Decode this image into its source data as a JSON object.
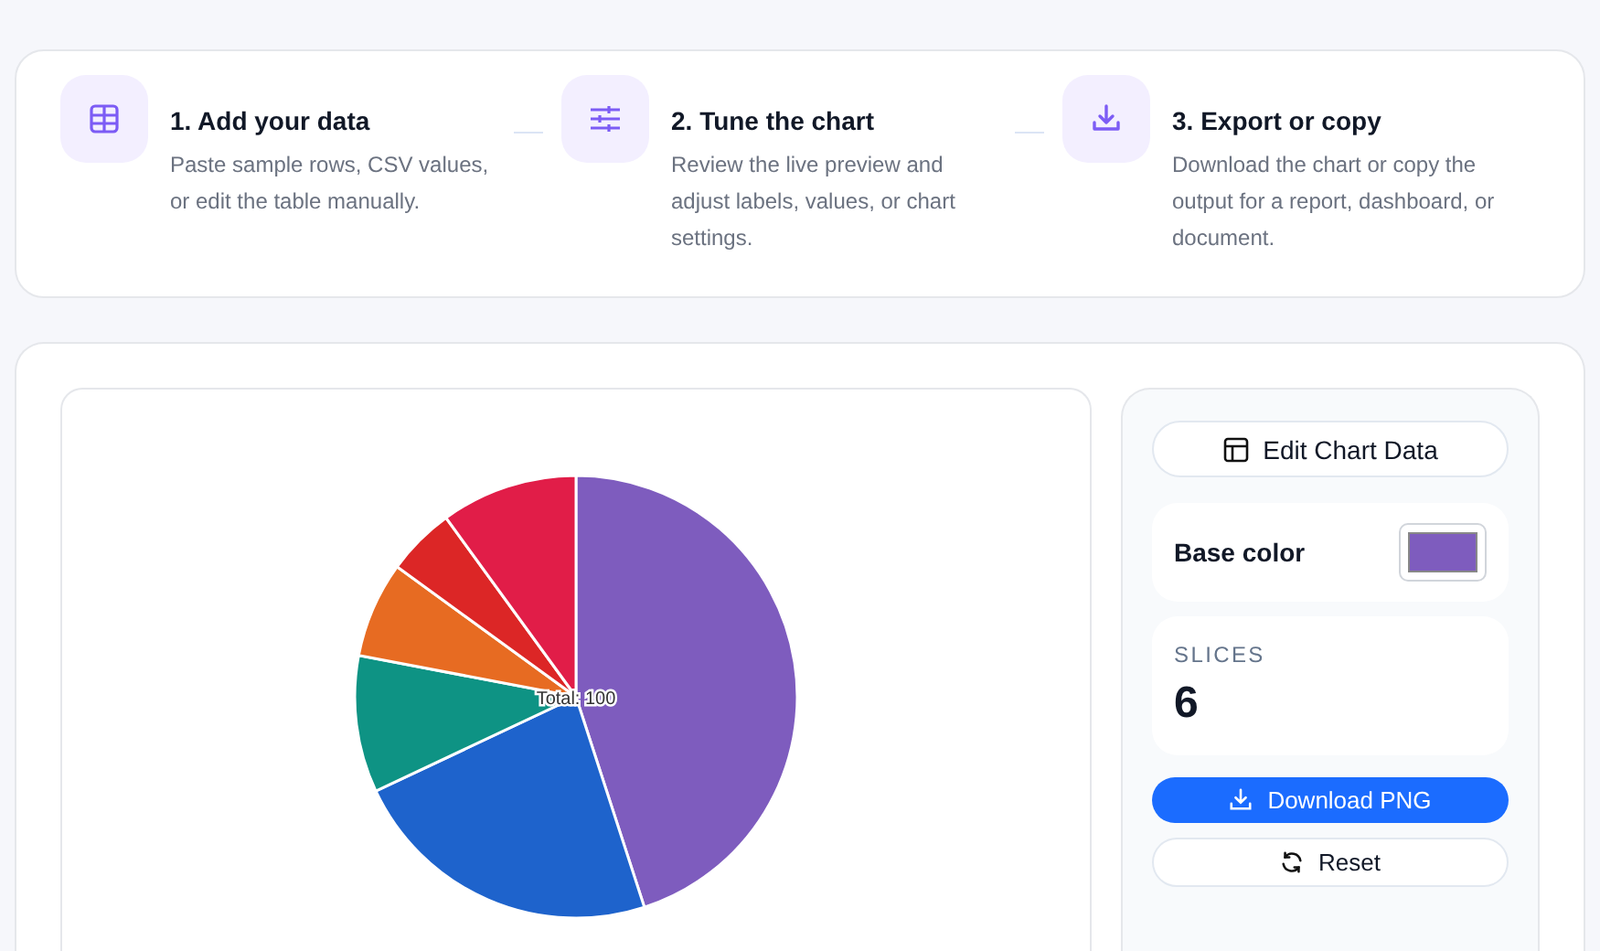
{
  "steps": [
    {
      "title": "1. Add your data",
      "text": "Paste sample rows, CSV values, or edit the table manually."
    },
    {
      "title": "2. Tune the chart",
      "text": "Review the live preview and adjust labels, values, or chart settings."
    },
    {
      "title": "3. Export or copy",
      "text": "Download the chart or copy the output for a report, dashboard, or document."
    }
  ],
  "chart": {
    "chart_data": {
      "type": "pie",
      "values": [
        45,
        23,
        10,
        7,
        5,
        10
      ],
      "colors": [
        "#7e5cbe",
        "#1e63cc",
        "#0e9384",
        "#e76b22",
        "#dc2626",
        "#e11d48"
      ],
      "annotations": [
        "Total: 100"
      ]
    }
  },
  "panel": {
    "edit_button": "Edit Chart Data",
    "base_color_label": "Base color",
    "color": "#7e5cbe",
    "slices_label": "SLICES",
    "slices_value": "6",
    "download_button": "Download PNG",
    "reset_button": "Reset"
  }
}
